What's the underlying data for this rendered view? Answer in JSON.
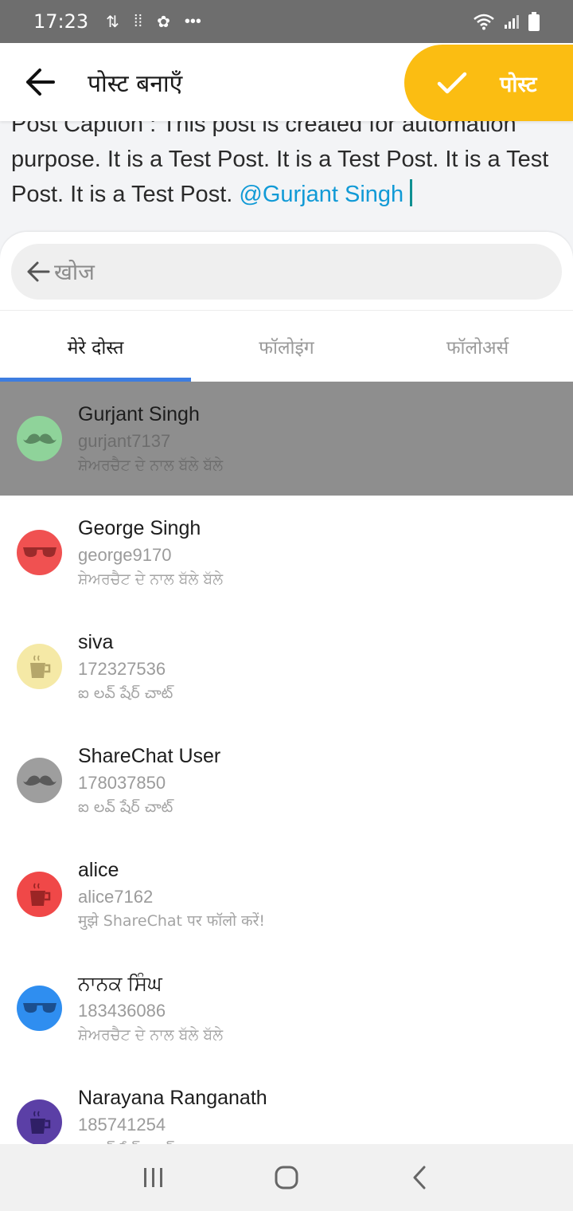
{
  "status_bar": {
    "time": "17:23"
  },
  "header": {
    "title": "पोस्ट बनाएँ",
    "post_button": "पोस्ट"
  },
  "caption": {
    "text": "Post Caption : This post is created for automation purpose. It is a Test Post. It is a Test Post. It is a Test Post. It is a Test Post.",
    "mention": "@Gurjant Singh"
  },
  "search": {
    "placeholder": "खोज"
  },
  "tabs": [
    "मेरे दोस्त",
    "फॉलोइंग",
    "फॉलोअर्स"
  ],
  "users": [
    {
      "name": "Gurjant Singh",
      "handle": "gurjant7137",
      "bio": "ਸ਼ੇਅਰਚੈਟ ਦੇ ਨਾਲ ਬੱਲੇ ਬੱਲੇ",
      "avatar_color": "#8fd39a",
      "avatar_icon": "mustache-icon"
    },
    {
      "name": "George Singh",
      "handle": "george9170",
      "bio": "ਸ਼ੇਅਰਚੈਟ ਦੇ ਨਾਲ ਬੱਲੇ ਬੱਲੇ",
      "avatar_color": "#f05151",
      "avatar_icon": "sunglasses-icon"
    },
    {
      "name": "siva",
      "handle": "172327536",
      "bio": "ఐ లవ్ షేర్ చాట్",
      "avatar_color": "#f5e9a6",
      "avatar_icon": "cup-icon"
    },
    {
      "name": "ShareChat User",
      "handle": "178037850",
      "bio": "ఐ లవ్ షేర్ చాట్",
      "avatar_color": "#9e9e9e",
      "avatar_icon": "mustache-icon"
    },
    {
      "name": "alice",
      "handle": "alice7162",
      "bio": "मुझे ShareChat पर फॉलो करें!",
      "avatar_color": "#f04848",
      "avatar_icon": "cup-icon"
    },
    {
      "name": "ਨਾਨਕ ਸਿੰਘ",
      "handle": "183436086",
      "bio": "ਸ਼ੇਅਰਚੈਟ ਦੇ ਨਾਲ ਬੱਲੇ ਬੱਲੇ",
      "avatar_color": "#2f8ef0",
      "avatar_icon": "sunglasses-icon"
    },
    {
      "name": "Narayana Ranganath",
      "handle": "185741254",
      "bio": "ఐ లవ్ షేర్ చాట్",
      "avatar_color": "#5b3fa6",
      "avatar_icon": "cup-icon"
    }
  ]
}
